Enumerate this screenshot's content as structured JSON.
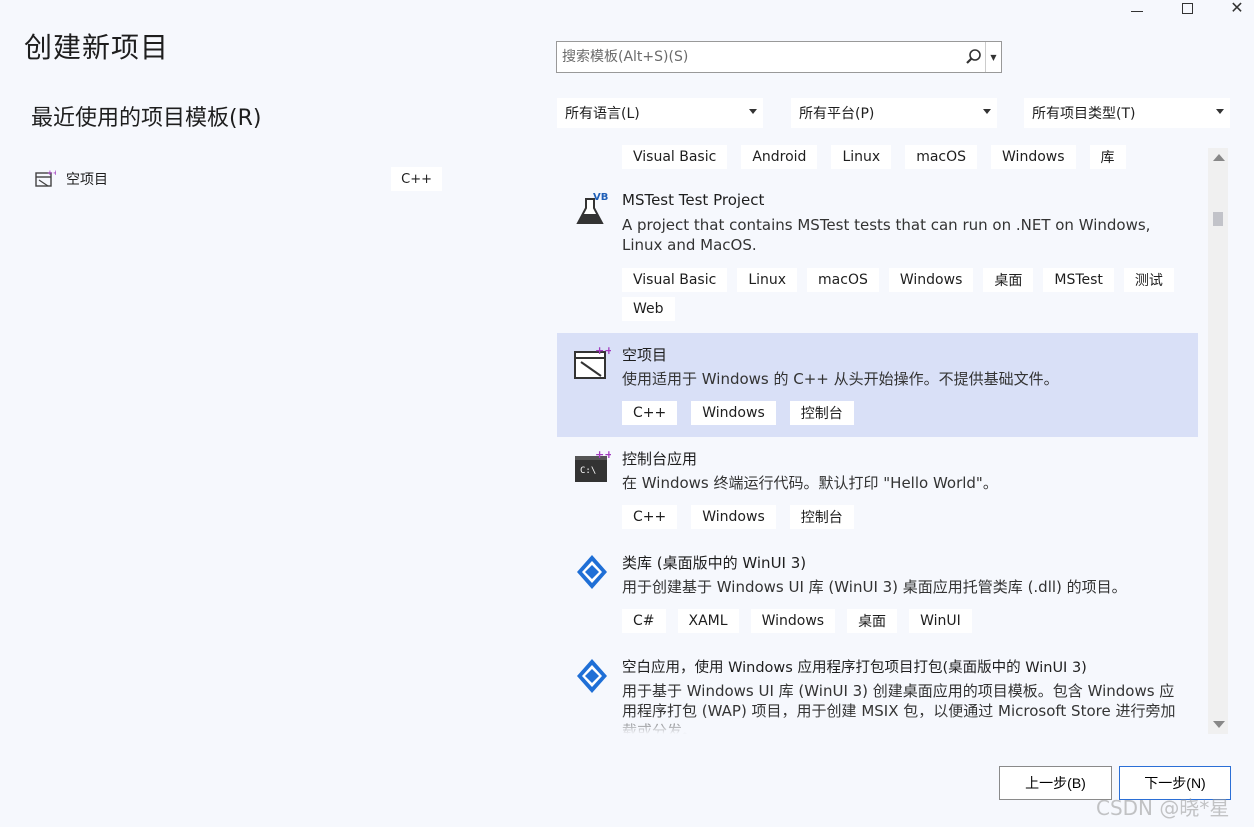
{
  "window": {
    "minimize_icon": "minimize-icon",
    "maximize_icon": "maximize-icon",
    "close_icon": "close-icon"
  },
  "page_title": "创建新项目",
  "recent": {
    "title": "最近使用的项目模板(R)",
    "items": [
      {
        "label": "空项目",
        "tag": "C++",
        "icon": "empty-project-icon"
      }
    ]
  },
  "search": {
    "placeholder": "搜索模板(Alt+S)(S)",
    "icon": "search-icon"
  },
  "filters": {
    "language": "所有语言(L)",
    "platform": "所有平台(P)",
    "project_type": "所有项目类型(T)"
  },
  "templates": [
    {
      "title": "",
      "description": "",
      "tags": [
        "Visual Basic",
        "Android",
        "Linux",
        "macOS",
        "Windows",
        "库"
      ]
    },
    {
      "title": "MSTest Test Project",
      "description": "A project that contains MSTest tests that can run on .NET on Windows, Linux and MacOS.",
      "tags": [
        "Visual Basic",
        "Linux",
        "macOS",
        "Windows",
        "桌面",
        "MSTest",
        "测试",
        "Web"
      ],
      "icon": "vb-test-flask-icon",
      "badge": "VB"
    },
    {
      "title": "空项目",
      "description": "使用适用于 Windows 的 C++ 从头开始操作。不提供基础文件。",
      "tags": [
        "C++",
        "Windows",
        "控制台"
      ],
      "icon": "empty-project-icon",
      "selected": true
    },
    {
      "title": "控制台应用",
      "description": "在 Windows 终端运行代码。默认打印 \"Hello World\"。",
      "tags": [
        "C++",
        "Windows",
        "控制台"
      ],
      "icon": "console-app-icon",
      "icon_text": "C:\\"
    },
    {
      "title": "类库 (桌面版中的 WinUI 3)",
      "description": "用于创建基于 Windows UI 库 (WinUI 3) 桌面应用托管类库 (.dll) 的项目。",
      "tags": [
        "C#",
        "XAML",
        "Windows",
        "桌面",
        "WinUI"
      ],
      "icon": "winui-icon"
    },
    {
      "title": "空白应用，使用 Windows 应用程序打包项目打包(桌面版中的 WinUI 3)",
      "description": "用于基于 Windows UI 库 (WinUI 3) 创建桌面应用的项目模板。包含 Windows 应用程序打包 (WAP) 项目，用于创建 MSIX 包，以便通过 Microsoft Store 进行旁加载或分发。",
      "tags": [],
      "icon": "winui-icon"
    }
  ],
  "buttons": {
    "back": "上一步(B)",
    "next": "下一步(N)"
  },
  "watermark": "CSDN @晓*星",
  "colors": {
    "selected_row": "#d9e0f7",
    "accent": "#2b6fd6",
    "background": "#f6f8fd"
  }
}
